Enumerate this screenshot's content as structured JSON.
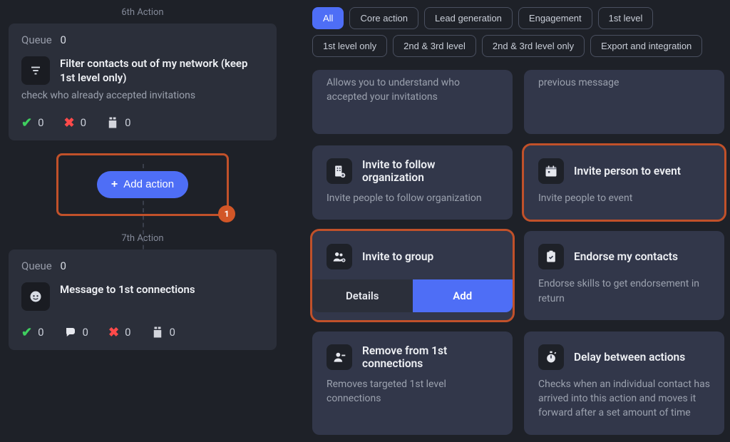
{
  "left": {
    "action6_label": "6th Action",
    "action7_label": "7th Action",
    "queue_label": "Queue",
    "queue_count_6": "0",
    "queue_count_7": "0",
    "step6_title": "Filter contacts out of my network (keep 1st level only)",
    "step6_sub": "check who already accepted invitations",
    "step7_title": "Message to 1st connections",
    "stats": {
      "check": "0",
      "cross": "0",
      "clip": "0",
      "speech": "0"
    },
    "add_action_label": "Add action",
    "badge": "1"
  },
  "filters": {
    "items": [
      {
        "label": "All",
        "active": true
      },
      {
        "label": "Core action",
        "active": false
      },
      {
        "label": "Lead generation",
        "active": false
      },
      {
        "label": "Engagement",
        "active": false
      },
      {
        "label": "1st level",
        "active": false
      },
      {
        "label": "1st level only",
        "active": false
      },
      {
        "label": "2nd & 3rd level",
        "active": false
      },
      {
        "label": "2nd & 3rd level only",
        "active": false
      },
      {
        "label": "Export and integration",
        "active": false
      }
    ]
  },
  "cards": {
    "top_left_desc": "Allows you to understand who accepted your invitations",
    "top_right_desc": "previous message",
    "invite_org_title": "Invite to follow organization",
    "invite_org_desc": "Invite people to follow organization",
    "invite_event_title": "Invite person to event",
    "invite_event_desc": "Invite people to event",
    "invite_group_title": "Invite to group",
    "details_label": "Details",
    "add_label": "Add",
    "endorse_title": "Endorse my contacts",
    "endorse_desc": "Endorse skills to get endorsement in return",
    "remove_title": "Remove from 1st connections",
    "remove_desc": "Removes targeted 1st level connections",
    "delay_title": "Delay between actions",
    "delay_desc": "Checks when an individual contact has arrived into this action and moves it forward after a set amount of time"
  }
}
